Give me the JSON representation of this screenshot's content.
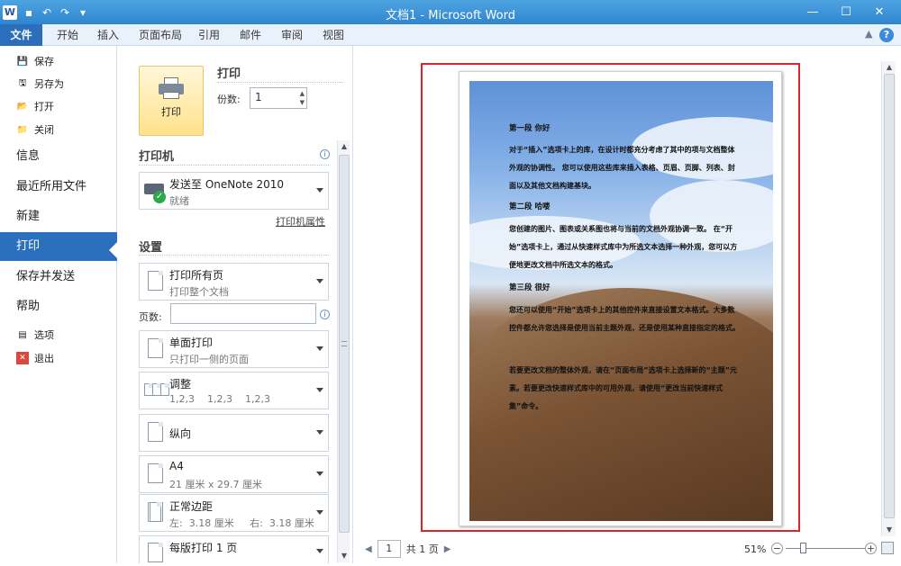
{
  "window": {
    "title": "文档1 - Microsoft Word",
    "logo": "W",
    "controls": [
      "minimize-icon",
      "maximize-icon",
      "close-icon"
    ]
  },
  "ribbon": {
    "tabs": [
      "文件",
      "开始",
      "插入",
      "页面布局",
      "引用",
      "邮件",
      "审阅",
      "视图"
    ],
    "help": "?"
  },
  "nav": {
    "items_small": [
      "保存",
      "另存为",
      "打开",
      "关闭"
    ],
    "items_big": [
      "信息",
      "最近所用文件",
      "新建",
      "打印",
      "保存并发送",
      "帮助"
    ],
    "items_bottom": [
      "选项",
      "退出"
    ],
    "selected": "打印",
    "accent": "#2b6fbf"
  },
  "print": {
    "button_label": "打印",
    "section_title": "打印",
    "copies_label": "份数:",
    "copies_value": "1",
    "printer_title": "打印机",
    "printer_name": "发送至 OneNote 2010",
    "printer_status": "就绪",
    "printer_props": "打印机属性",
    "settings_title": "设置",
    "options": [
      {
        "l1": "打印所有页",
        "l2": "打印整个文档"
      },
      {
        "l1": "单面打印",
        "l2": "只打印一侧的页面"
      },
      {
        "l1": "调整",
        "l2": "1,2,3    1,2,3    1,2,3"
      },
      {
        "l1": "纵向",
        "l2": ""
      },
      {
        "l1": "A4",
        "l2": "21 厘米 x 29.7 厘米"
      },
      {
        "l1": "正常边距",
        "l2": "左:  3.18 厘米     右:  3.18 厘米"
      },
      {
        "l1": "每版打印 1 页",
        "l2": ""
      }
    ],
    "pages_label": "页数:",
    "pages_value": ""
  },
  "preview": {
    "heading1": "第一段  你好",
    "para1": "对于“插入”选项卡上的库，在设计时都充分考虑了其中的项与文档整体外观的协调性。 您可以使用这些库来插入表格、页眉、页脚、列表、封面以及其他文档构建基块。",
    "heading2": "第二段  哈喽",
    "para2": "您创建的图片、图表或关系图也将与当前的文档外观协调一致。 在“开始”选项卡上，通过从快速样式库中为所选文本选择一种外观，您可以方便地更改文档中所选文本的格式。",
    "heading3": "第三段  很好",
    "para3": "您还可以使用“开始”选项卡上的其他控件来直接设置文本格式。大多数控件都允许您选择是使用当前主题外观，还是使用某种直接指定的格式。",
    "para4": "若要更改文档的整体外观，请在“页面布局”选项卡上选择新的“主题”元素。若要更改快速样式库中的可用外观，请使用“更改当前快速样式集”命令。",
    "highlight_color": "#e1222a"
  },
  "status": {
    "page_current": "1",
    "page_total": "共 1 页",
    "zoom": "51%"
  }
}
